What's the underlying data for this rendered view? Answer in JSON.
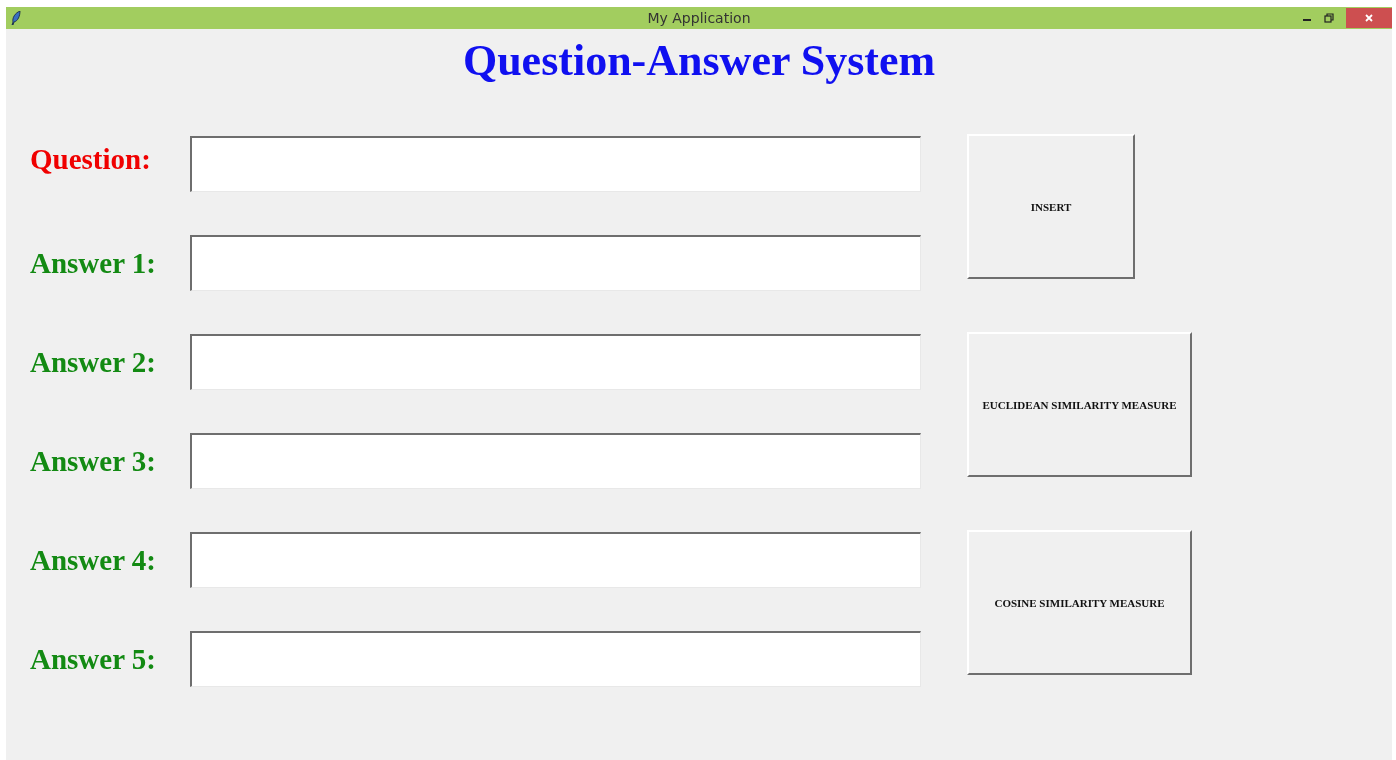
{
  "window": {
    "title": "My Application"
  },
  "heading": "Question-Answer System",
  "fields": [
    {
      "label": "Question:",
      "kind": "question"
    },
    {
      "label": "Answer 1:",
      "kind": "answer"
    },
    {
      "label": "Answer 2:",
      "kind": "answer"
    },
    {
      "label": "Answer 3:",
      "kind": "answer"
    },
    {
      "label": "Answer 4:",
      "kind": "answer"
    },
    {
      "label": "Answer 5:",
      "kind": "answer"
    }
  ],
  "buttons": [
    {
      "label": "INSERT",
      "kind": "narrow"
    },
    {
      "label": "EUCLIDEAN SIMILARITY MEASURE",
      "kind": "wide"
    },
    {
      "label": "COSINE SIMILARITY MEASURE",
      "kind": "wide"
    }
  ]
}
